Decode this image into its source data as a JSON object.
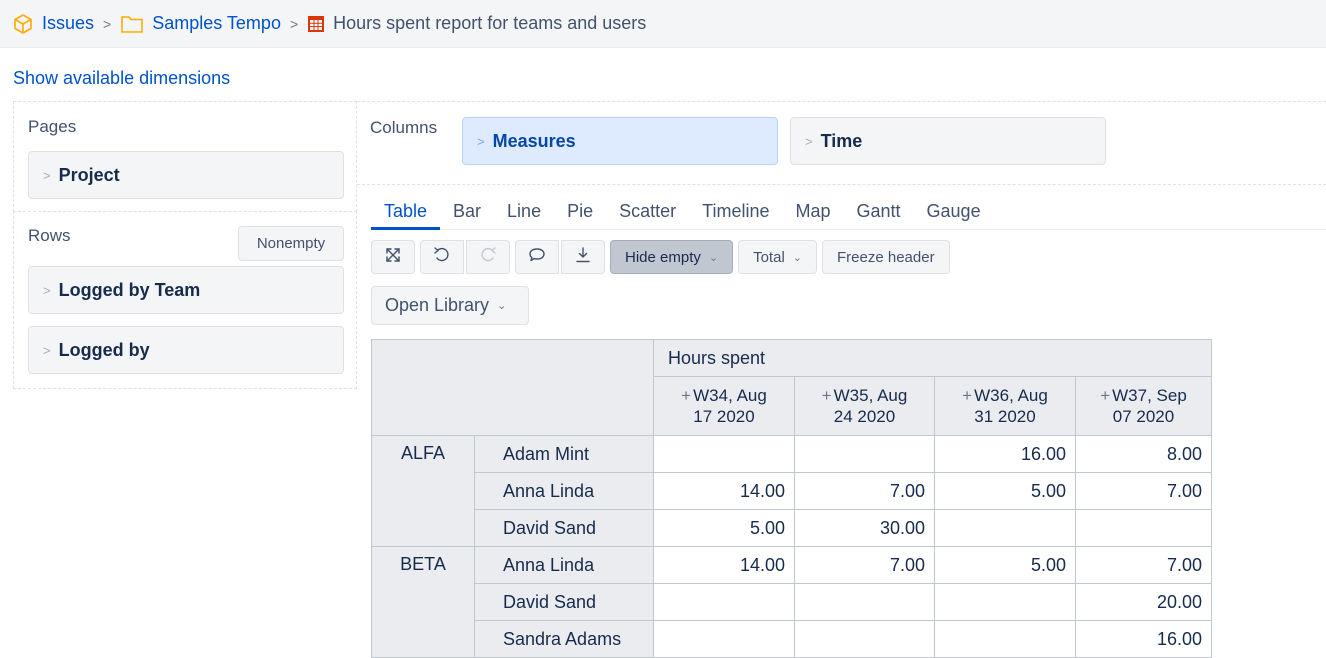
{
  "breadcrumb": {
    "issues": "Issues",
    "project": "Samples Tempo",
    "report": "Hours spent report for teams and users",
    "separator": ">"
  },
  "show_dims": "Show available dimensions",
  "pages": {
    "title": "Pages",
    "items": [
      "Project"
    ]
  },
  "rows": {
    "title": "Rows",
    "nonempty": "Nonempty",
    "items": [
      "Logged by Team",
      "Logged by"
    ]
  },
  "columns": {
    "title": "Columns",
    "items": [
      "Measures",
      "Time"
    ]
  },
  "chevron": ">",
  "tabs": [
    "Table",
    "Bar",
    "Line",
    "Pie",
    "Scatter",
    "Timeline",
    "Map",
    "Gantt",
    "Gauge"
  ],
  "active_tab": "Table",
  "toolbar": {
    "icons": [
      "expand-icon",
      "undo-icon",
      "redo-icon",
      "comment-icon",
      "download-icon"
    ],
    "hide_empty": "Hide empty",
    "total": "Total",
    "freeze": "Freeze header"
  },
  "open_library": "Open Library",
  "table": {
    "measure": "Hours spent",
    "plus": "+",
    "col_headers": [
      [
        "W34, Aug",
        "17 2020"
      ],
      [
        "W35, Aug",
        "24 2020"
      ],
      [
        "W36, Aug",
        "31 2020"
      ],
      [
        "W37, Sep",
        "07 2020"
      ]
    ],
    "groups": [
      {
        "team": "ALFA",
        "rows": [
          {
            "user": "Adam Mint",
            "values": [
              "",
              "",
              "16.00",
              "8.00"
            ]
          },
          {
            "user": "Anna Linda",
            "values": [
              "14.00",
              "7.00",
              "5.00",
              "7.00"
            ]
          },
          {
            "user": "David Sand",
            "values": [
              "5.00",
              "30.00",
              "",
              ""
            ]
          }
        ]
      },
      {
        "team": "BETA",
        "rows": [
          {
            "user": "Anna Linda",
            "values": [
              "14.00",
              "7.00",
              "5.00",
              "7.00"
            ]
          },
          {
            "user": "David Sand",
            "values": [
              "",
              "",
              "",
              "20.00"
            ]
          },
          {
            "user": "Sandra Adams",
            "values": [
              "",
              "",
              "",
              "16.00"
            ]
          }
        ]
      }
    ]
  },
  "colors": {
    "link": "#0052cc",
    "header_bg": "#ebecf0",
    "measures_bg": "#deebff",
    "hide_empty_bg": "#c1c7d0",
    "cube_icon": "#ffab00",
    "table_icon": "#de350b"
  }
}
